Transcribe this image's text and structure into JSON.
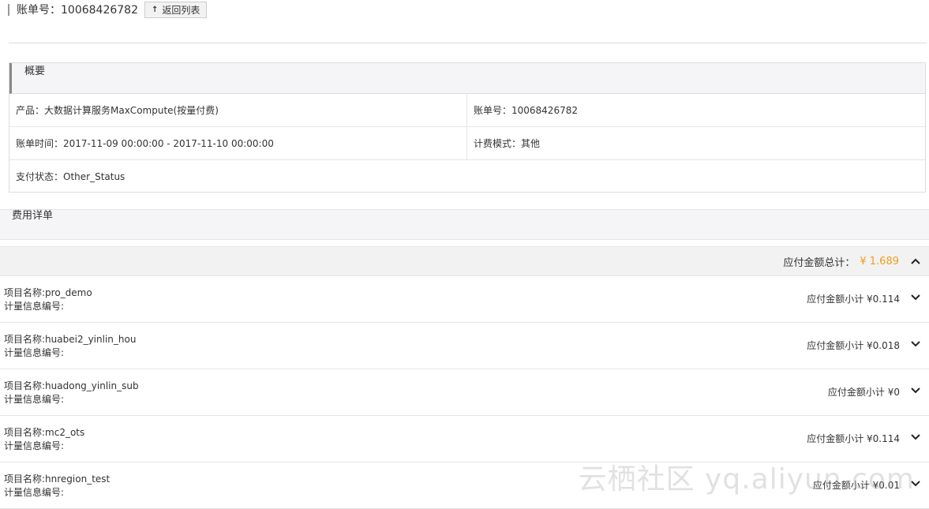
{
  "header": {
    "title": "账单号：10068426782",
    "back_label": "返回列表",
    "back_icon": "up-arrow-icon"
  },
  "summary": {
    "heading": "概要",
    "product": "产品：大数据计算服务MaxCompute(按量付费)",
    "bill_no": "账单号：10068426782",
    "bill_time": "账单时间：2017-11-09 00:00:00 -  2017-11-10 00:00:00",
    "billing_mode": "计费模式：其他",
    "pay_status": "支付状态：Other_Status"
  },
  "fee": {
    "heading": "费用详单",
    "total_label": "应付金额总计：",
    "total_amount": "¥ 1.689",
    "total_color": "#f39c1e",
    "items": [
      {
        "project": "项目名称:pro_demo",
        "meter": "计量信息编号:",
        "subtotal": "应付金额小计 ¥0.114"
      },
      {
        "project": "项目名称:huabei2_yinlin_hou",
        "meter": "计量信息编号:",
        "subtotal": "应付金额小计 ¥0.018"
      },
      {
        "project": "项目名称:huadong_yinlin_sub",
        "meter": "计量信息编号:",
        "subtotal": "应付金额小计 ¥0"
      },
      {
        "project": "项目名称:mc2_ots",
        "meter": "计量信息编号:",
        "subtotal": "应付金额小计 ¥0.114"
      },
      {
        "project": "项目名称:hnregion_test",
        "meter": "计量信息编号:",
        "subtotal": "应付金额小计 ¥0.01"
      }
    ]
  },
  "watermark": "云栖社区 yq.aliyun.com"
}
